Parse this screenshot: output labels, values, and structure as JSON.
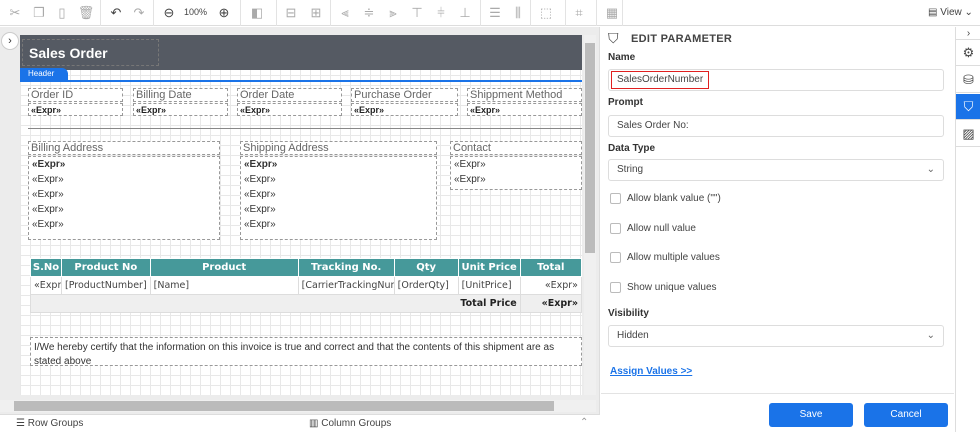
{
  "toolbar": {
    "zoom": "100%",
    "view_label": "View"
  },
  "report": {
    "title": "Sales Order",
    "header_tab": "Header",
    "fields": [
      {
        "label": "Order ID",
        "value": "«Expr»"
      },
      {
        "label": "Billing Date",
        "value": "«Expr»"
      },
      {
        "label": "Order Date",
        "value": "«Expr»"
      },
      {
        "label": "Purchase Order",
        "value": "«Expr»"
      },
      {
        "label": "Shippment Method",
        "value": "«Expr»"
      }
    ],
    "billing": {
      "label": "Billing Address",
      "lines": [
        "«Expr»",
        "«Expr»",
        "«Expr»",
        "«Expr»",
        "«Expr»"
      ]
    },
    "shipping": {
      "label": "Shipping Address",
      "lines": [
        "«Expr»",
        "«Expr»",
        "«Expr»",
        "«Expr»",
        "«Expr»"
      ]
    },
    "contact": {
      "label": "Contact",
      "lines": [
        "«Expr»",
        "«Expr»"
      ]
    },
    "table": {
      "headers": [
        "S.No",
        "Product No",
        "Product",
        "Tracking No.",
        "Qty",
        "Unit Price",
        "Total"
      ],
      "row": [
        "«Expr»",
        "[ProductNumber]",
        "[Name]",
        "[CarrierTrackingNumber]",
        "[OrderQty]",
        "[UnitPrice]",
        "«Expr»"
      ],
      "total_label": "Total Price",
      "total_value": "«Expr»"
    },
    "certify": "I/We hereby certify that the information on this invoice is true and correct and that the contents of this shipment are as stated above"
  },
  "bottom": {
    "row_groups": "Row Groups",
    "column_groups": "Column Groups"
  },
  "panel": {
    "title": "EDIT PARAMETER",
    "name_label": "Name",
    "name_value": "SalesOrderNumber",
    "prompt_label": "Prompt",
    "prompt_value": "Sales Order No:",
    "datatype_label": "Data Type",
    "datatype_value": "String",
    "checkboxes": [
      "Allow blank value (\"\")",
      "Allow null value",
      "Allow multiple values",
      "Show unique values"
    ],
    "visibility_label": "Visibility",
    "visibility_value": "Hidden",
    "assign_link": "Assign Values >>",
    "save": "Save",
    "cancel": "Cancel"
  },
  "colors": {
    "accent": "#1a73e8",
    "table_header": "#46999a",
    "report_band": "#555a63",
    "highlight": "#e02020"
  }
}
